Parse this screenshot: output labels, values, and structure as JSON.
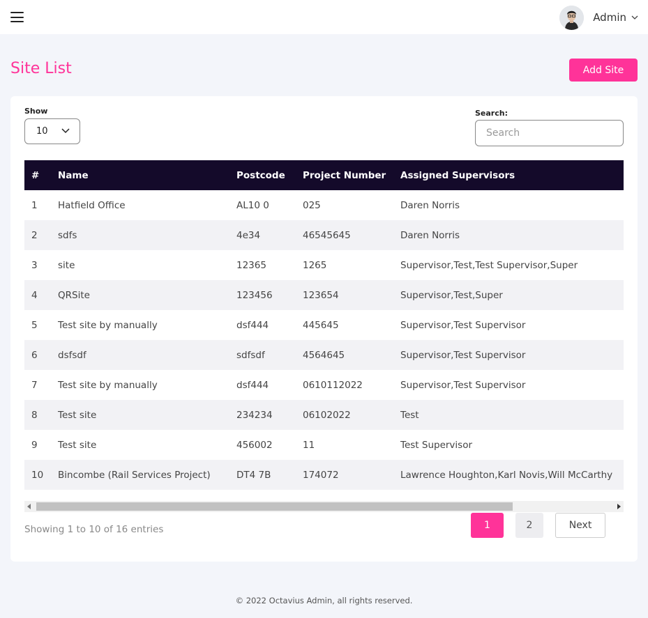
{
  "header": {
    "user_name": "Admin",
    "menu_icon": "hamburger-icon",
    "dropdown_icon": "chevron-down-icon"
  },
  "page": {
    "title": "Site List",
    "add_button": "Add Site",
    "accent_color": "#ff3399",
    "header_bg_color": "#140a2a"
  },
  "controls": {
    "show_label": "Show",
    "show_value": "10",
    "search_label": "Search:",
    "search_placeholder": "Search"
  },
  "table": {
    "columns": [
      "#",
      "Name",
      "Postcode",
      "Project Number",
      "Assigned Supervisors"
    ],
    "rows": [
      [
        "1",
        "Hatfield Office",
        "AL10 0",
        "025",
        "Daren Norris"
      ],
      [
        "2",
        "sdfs",
        "4e34",
        "46545645",
        "Daren Norris"
      ],
      [
        "3",
        "site",
        "12365",
        "1265",
        "Supervisor,Test,Test Supervisor,Super"
      ],
      [
        "4",
        "QRSite",
        "123456",
        "123654",
        "Supervisor,Test,Super"
      ],
      [
        "5",
        "Test site by manually",
        "dsf444",
        "445645",
        "Supervisor,Test Supervisor"
      ],
      [
        "6",
        "dsfsdf",
        "sdfsdf",
        "4564645",
        "Supervisor,Test Supervisor"
      ],
      [
        "7",
        "Test site by manually",
        "dsf444",
        "0610112022",
        "Supervisor,Test Supervisor"
      ],
      [
        "8",
        "Test site",
        "234234",
        "06102022",
        "Test"
      ],
      [
        "9",
        "Test site",
        "456002",
        "11",
        "Test Supervisor"
      ],
      [
        "10",
        "Bincombe (Rail Services Project)",
        "DT4 7B",
        "174072",
        "Lawrence Houghton,Karl Novis,Will McCarthy"
      ]
    ]
  },
  "pagination": {
    "info": "Showing 1 to 10 of 16 entries",
    "page1": "1",
    "page2": "2",
    "next": "Next"
  },
  "footer": {
    "text": "© 2022 Octavius Admin, all rights reserved."
  }
}
